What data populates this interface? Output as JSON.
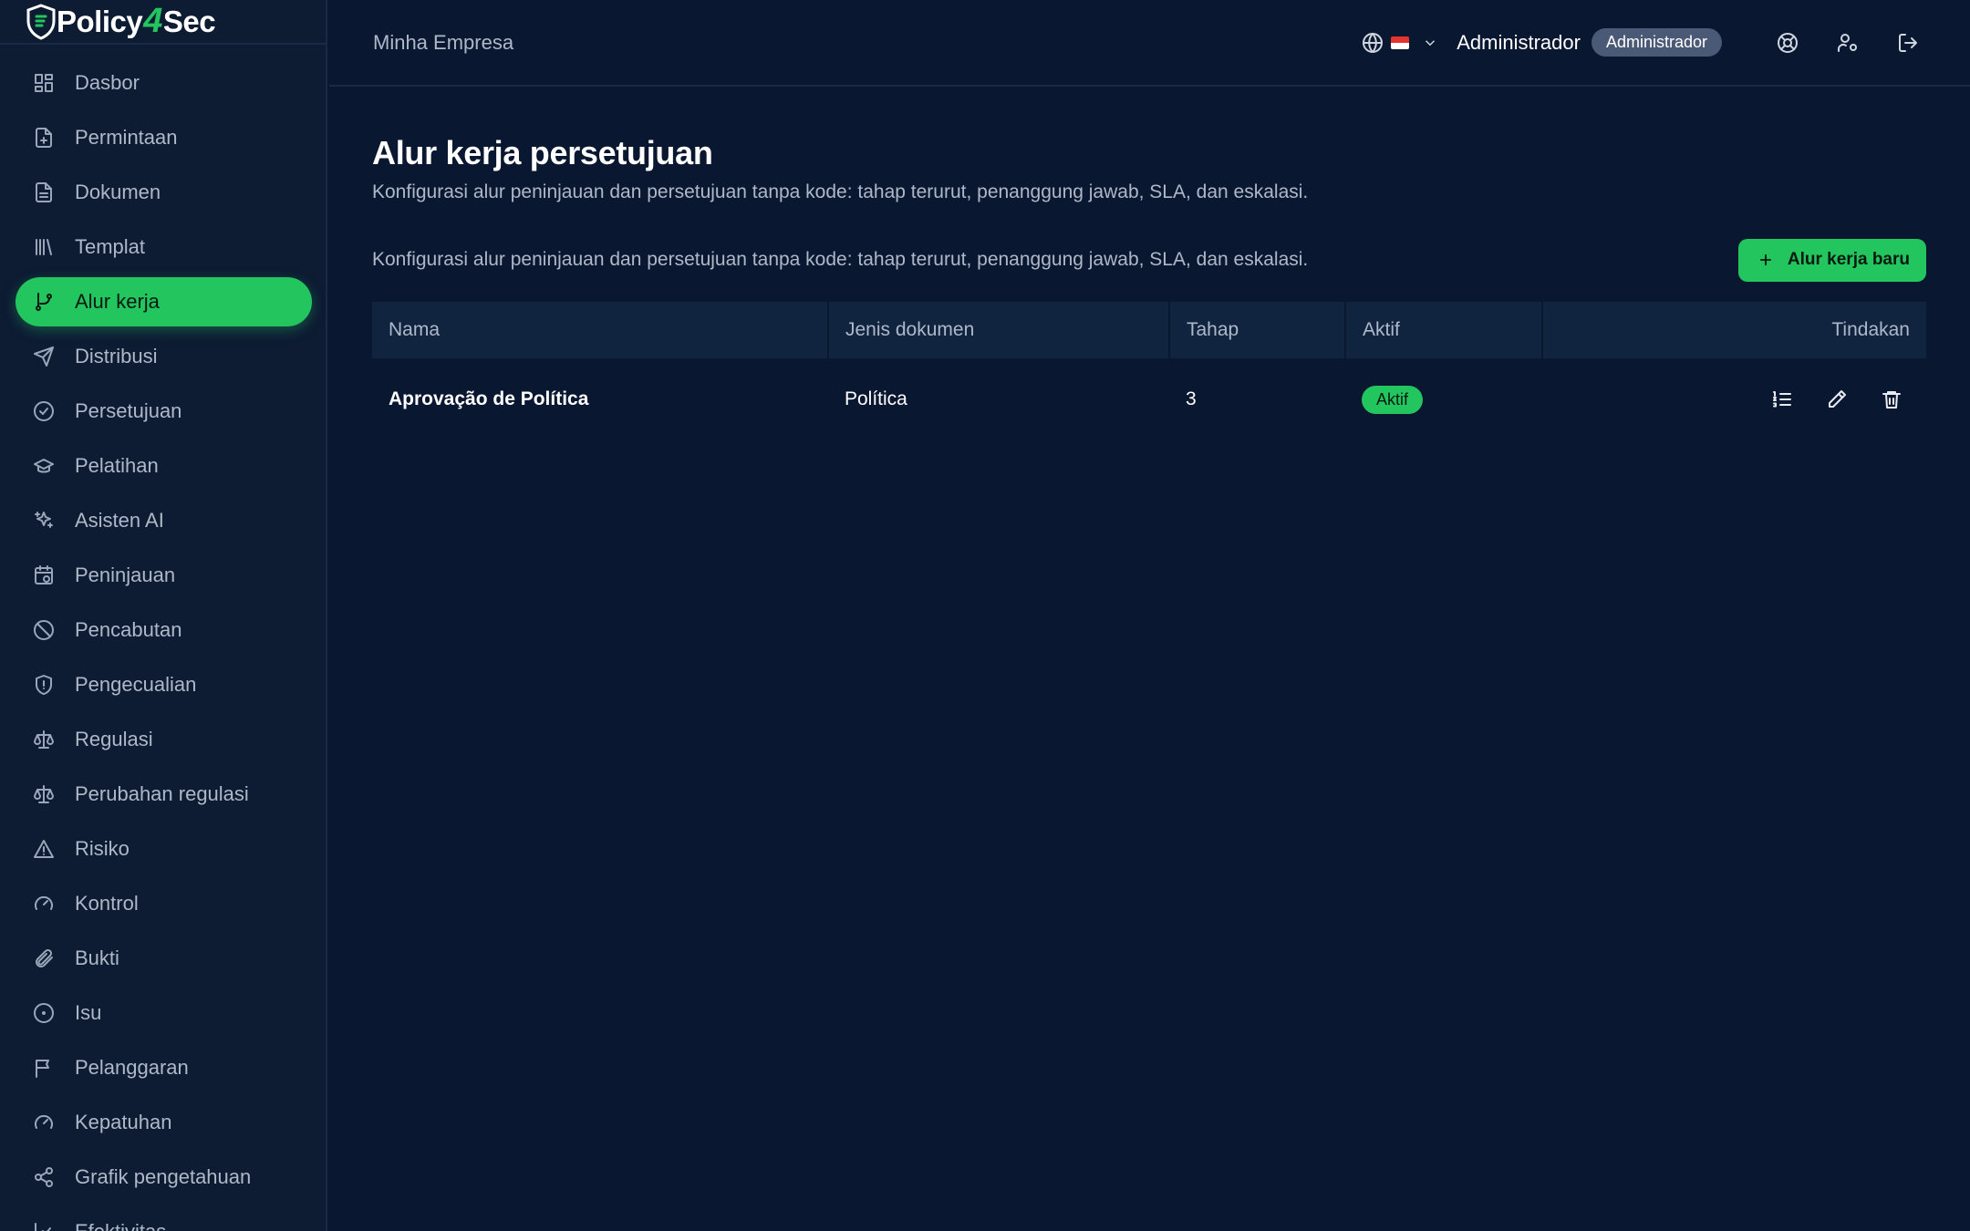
{
  "brand": {
    "name_part1": "Policy",
    "name_part2": "4",
    "name_part3": "Sec"
  },
  "sidebar": {
    "items": [
      {
        "label": "Dasbor",
        "icon": "dashboard-icon"
      },
      {
        "label": "Permintaan",
        "icon": "file-plus-icon"
      },
      {
        "label": "Dokumen",
        "icon": "document-icon"
      },
      {
        "label": "Templat",
        "icon": "library-icon"
      },
      {
        "label": "Alur kerja",
        "icon": "git-branch-icon",
        "active": true
      },
      {
        "label": "Distribusi",
        "icon": "send-icon"
      },
      {
        "label": "Persetujuan",
        "icon": "check-circle-icon"
      },
      {
        "label": "Pelatihan",
        "icon": "graduation-cap-icon"
      },
      {
        "label": "Asisten AI",
        "icon": "sparkles-icon"
      },
      {
        "label": "Peninjauan",
        "icon": "calendar-clock-icon"
      },
      {
        "label": "Pencabutan",
        "icon": "ban-icon"
      },
      {
        "label": "Pengecualian",
        "icon": "shield-alert-icon"
      },
      {
        "label": "Regulasi",
        "icon": "scale-icon"
      },
      {
        "label": "Perubahan regulasi",
        "icon": "scale-icon"
      },
      {
        "label": "Risiko",
        "icon": "alert-triangle-icon"
      },
      {
        "label": "Kontrol",
        "icon": "gauge-icon"
      },
      {
        "label": "Bukti",
        "icon": "paperclip-icon"
      },
      {
        "label": "Isu",
        "icon": "dot-circle-icon"
      },
      {
        "label": "Pelanggaran",
        "icon": "flag-icon"
      },
      {
        "label": "Kepatuhan",
        "icon": "gauge-icon"
      },
      {
        "label": "Grafik pengetahuan",
        "icon": "share-nodes-icon"
      },
      {
        "label": "Efektivitas",
        "icon": "chart-icon"
      }
    ]
  },
  "topbar": {
    "org_name": "Minha Empresa",
    "user_name": "Administrador",
    "role_badge": "Administrador"
  },
  "main": {
    "title": "Alur kerja persetujuan",
    "subtitle": "Konfigurasi alur peninjauan dan persetujuan tanpa kode: tahap terurut, penanggung jawab, SLA, dan eskalasi.",
    "description": "Konfigurasi alur peninjauan dan persetujuan tanpa kode: tahap terurut, penanggung jawab, SLA, dan eskalasi.",
    "new_button": "Alur kerja baru",
    "table": {
      "headers": [
        "Nama",
        "Jenis dokumen",
        "Tahap",
        "Aktif",
        "Tindakan"
      ],
      "rows": [
        {
          "name": "Aprovação de Política",
          "doc_type": "Política",
          "stages": "3",
          "status": "Aktif"
        }
      ]
    }
  },
  "colors": {
    "accent": "#22c55e",
    "background": "#0a1730",
    "sidebar": "#0d1b33"
  }
}
